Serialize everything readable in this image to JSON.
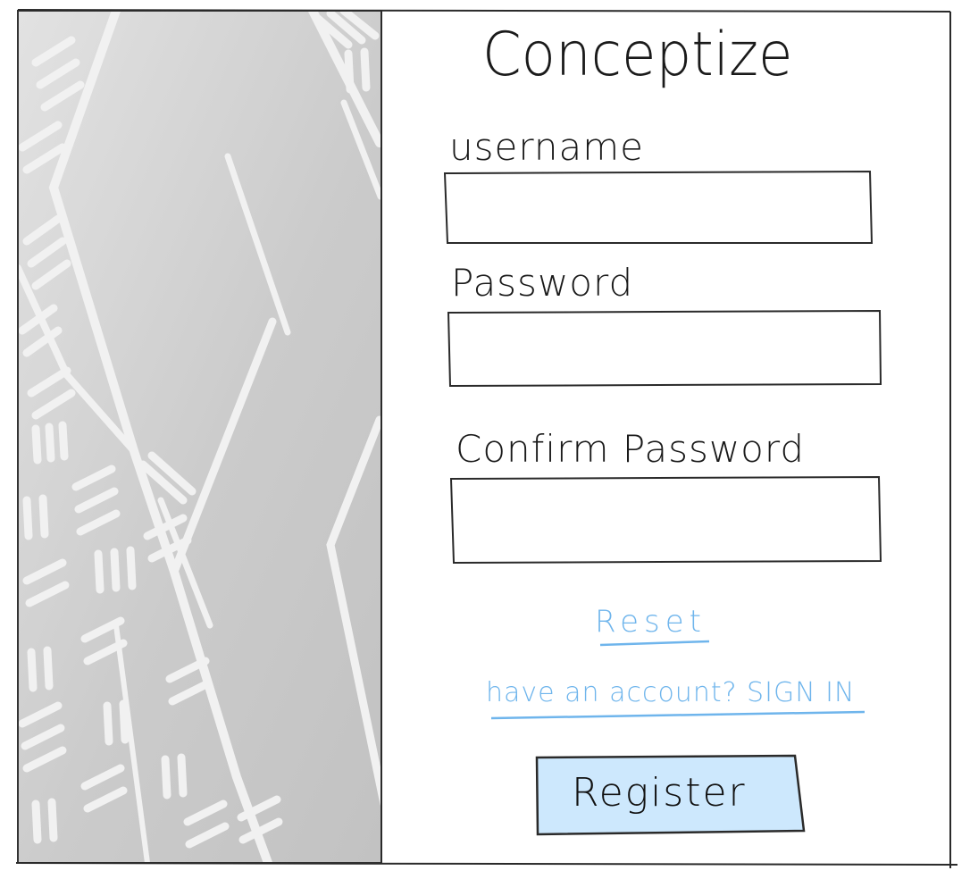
{
  "app": {
    "title": "Conceptize"
  },
  "form": {
    "username_label": "username",
    "password_label": "Password",
    "confirm_label": "Confirm Password",
    "username_value": "",
    "password_value": "",
    "confirm_value": ""
  },
  "links": {
    "reset": "Reset",
    "signin": "have an account? SIGN IN"
  },
  "actions": {
    "register": "Register"
  },
  "colors": {
    "link": "#6fb5ec",
    "button_fill": "#cde8fd",
    "image_panel": "#cfcfcf",
    "ink": "#1a1a1a"
  }
}
